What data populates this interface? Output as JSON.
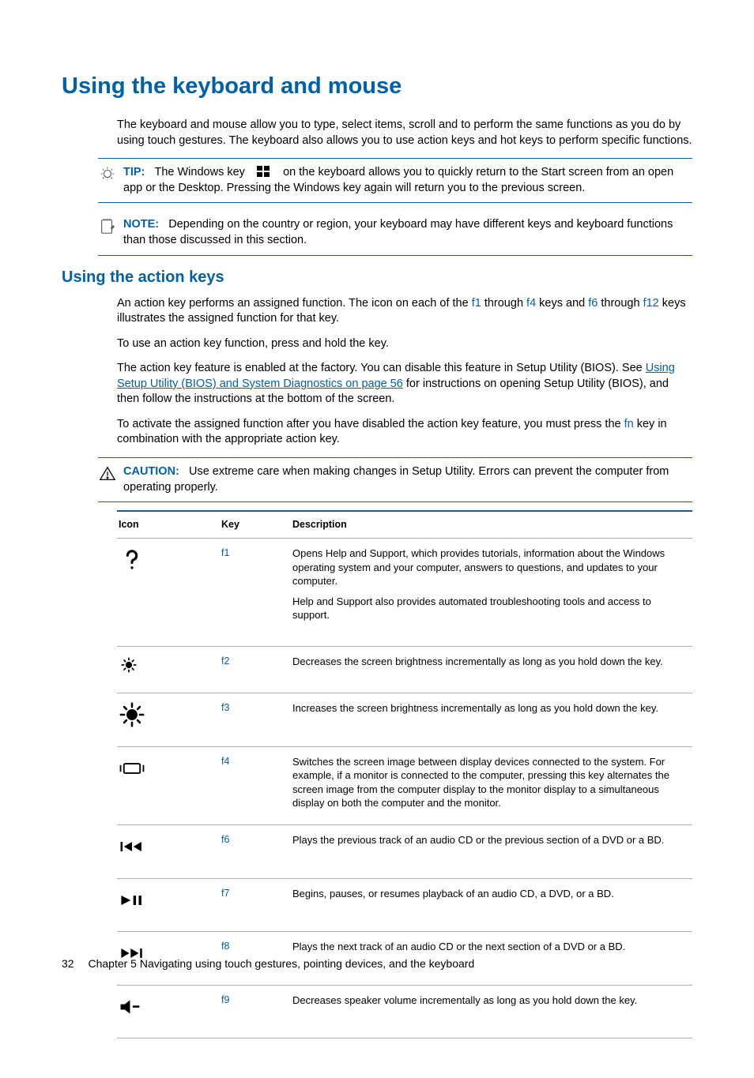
{
  "heading_main": "Using the keyboard and mouse",
  "intro_para": "The keyboard and mouse allow you to type, select items, scroll and to perform the same functions as you do by using touch gestures. The keyboard also allows you to use action keys and hot keys to perform specific functions.",
  "tip": {
    "label": "TIP:",
    "text_before_icon": "The Windows key",
    "text_after_icon": "on the keyboard allows you to quickly return to the Start screen from an open app or the Desktop. Pressing the Windows key again will return you to the previous screen."
  },
  "note": {
    "label": "NOTE:",
    "text": "Depending on the country or region, your keyboard may have different keys and keyboard functions than those discussed in this section."
  },
  "heading_action": "Using the action keys",
  "action_para1_a": "An action key performs an assigned function. The icon on each of the ",
  "action_f1": "f1",
  "action_para1_b": " through ",
  "action_f4": "f4",
  "action_para1_c": " keys and ",
  "action_f6": "f6",
  "action_para1_d": " through ",
  "action_f12": "f12",
  "action_para1_e": " keys illustrates the assigned function for that key.",
  "action_para2": "To use an action key function, press and hold the key.",
  "action_para3_a": "The action key feature is enabled at the factory. You can disable this feature in Setup Utility (BIOS). See ",
  "action_link": "Using Setup Utility (BIOS) and System Diagnostics on page 56",
  "action_para3_b": " for instructions on opening Setup Utility (BIOS), and then follow the instructions at the bottom of the screen.",
  "action_para4_a": "To activate the assigned function after you have disabled the action key feature, you must press the ",
  "action_fn": "fn",
  "action_para4_b": " key in combination with the appropriate action key.",
  "caution": {
    "label": "CAUTION:",
    "text": "Use extreme care when making changes in Setup Utility. Errors can prevent the computer from operating properly."
  },
  "table": {
    "headers": {
      "icon": "Icon",
      "key": "Key",
      "desc": "Description"
    },
    "rows": [
      {
        "key": "f1",
        "desc": "Opens Help and Support, which provides tutorials, information about the Windows operating system and your computer, answers to questions, and updates to your computer.",
        "desc2": "Help and Support also provides automated troubleshooting tools and access to support."
      },
      {
        "key": "f2",
        "desc": "Decreases the screen brightness incrementally as long as you hold down the key."
      },
      {
        "key": "f3",
        "desc": "Increases the screen brightness incrementally as long as you hold down the key."
      },
      {
        "key": "f4",
        "desc": "Switches the screen image between display devices connected to the system. For example, if a monitor is connected to the computer, pressing this key alternates the screen image from the computer display to the monitor display to a simultaneous display on both the computer and the monitor."
      },
      {
        "key": "f6",
        "desc": "Plays the previous track of an audio CD or the previous section of a DVD or a BD."
      },
      {
        "key": "f7",
        "desc": "Begins, pauses, or resumes playback of an audio CD, a DVD, or a BD."
      },
      {
        "key": "f8",
        "desc": "Plays the next track of an audio CD or the next section of a DVD or a BD."
      },
      {
        "key": "f9",
        "desc": "Decreases speaker volume incrementally as long as you hold down the key."
      }
    ]
  },
  "footer": {
    "page": "32",
    "chapter": "Chapter 5   Navigating using touch gestures, pointing devices, and the keyboard"
  }
}
